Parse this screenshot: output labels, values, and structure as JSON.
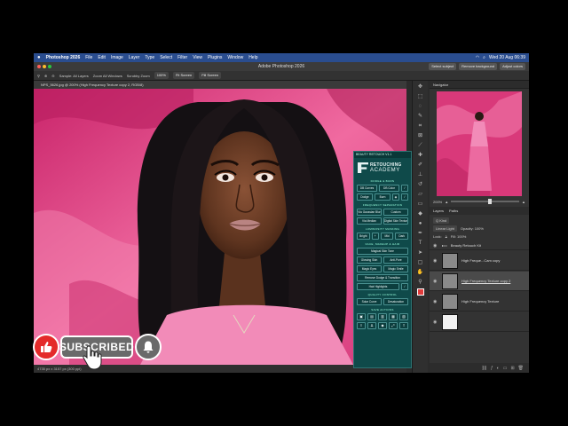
{
  "menubar": {
    "app": "Photoshop 2026",
    "items": [
      "File",
      "Edit",
      "Image",
      "Layer",
      "Type",
      "Select",
      "Filter",
      "View",
      "Plugins",
      "Window",
      "Help"
    ],
    "clock": "Wed 20 Aug 06:39"
  },
  "titlebar": {
    "title": "Adobe Photoshop 2026",
    "select_subject": "Select subject",
    "remove_background": "Remove background",
    "adjust_colors": "Adjust colors"
  },
  "optionsbar": {
    "sample": "Sample: All Layers",
    "zoom_all": "Zoom All Windows",
    "scrubby": "Scrubby Zoom",
    "pct": "100%",
    "fit": "Fit Screen",
    "fill": "Fill Screen"
  },
  "document": {
    "tab": "NPS_5626.jpg @ 200% (High Frequency Texture copy 2, RGB/8)",
    "status": "4735 px x 3157 px (300 ppi)"
  },
  "navigator": {
    "tab": "Navigator",
    "zoom": "200%"
  },
  "layers": {
    "tabs": [
      "Layers",
      "Paths"
    ],
    "kind": "Q Kind",
    "blend": "Linear Light",
    "opacity": "Opacity: 100%",
    "lock": "Lock:",
    "fill": "Fill: 100%",
    "items": [
      {
        "name": "Beauty Retouch Kit",
        "type": "folder"
      },
      {
        "name": "High Freque...Cam copy",
        "type": "layer"
      },
      {
        "name": "High Frequency Texture copy 2",
        "type": "layer",
        "selected": true
      },
      {
        "name": "High Frequency Texture",
        "type": "layer"
      }
    ]
  },
  "beauty_panel": {
    "header": "BEAUTY RETOUCH V1.1",
    "logo_line1": "RETOUCHING",
    "logo_line2": "ACADEMY",
    "sections": {
      "dodge_burn": "DODGE & BURN",
      "freq_sep": "FREQUENCY SEPARATION",
      "luminosity": "LUMINOSITY MASKING",
      "face": "FACE, MAKEUP & HAIR",
      "quality": "QUALITY CONTROL",
      "save": "SAVE ACTIONS"
    },
    "db_curves": "DB Curves",
    "db_color": "DB Color",
    "dodge": "Dodge",
    "burn": "Burn",
    "via_gaussian": "Via Gaussian Blur",
    "custom": "Custom",
    "via_median": "Via Median",
    "digital_skin": "Digital Skin Texture",
    "brand": "Bright",
    "mid": "Mid",
    "dark": "Dark",
    "magical_skin": "Magical Skin Tone",
    "glowing_skin": "Glowing Skin",
    "anti_pore": "Anti-Pore",
    "magic_eyes": "Magic Eyes",
    "magic_smile": "Magic Smile",
    "remove_dodge": "Remove Dodge & Transition",
    "hair_highlights": "Hair Highlights",
    "solar_curve": "Solar Curve",
    "desaturate": "Desaturation"
  },
  "overlay": {
    "subscribed": "SUBSCRIBED"
  },
  "colors": {
    "accent_teal": "#0f4a4a",
    "backdrop_pink": "#e0407f",
    "menubar_blue": "#2a4d8f"
  }
}
